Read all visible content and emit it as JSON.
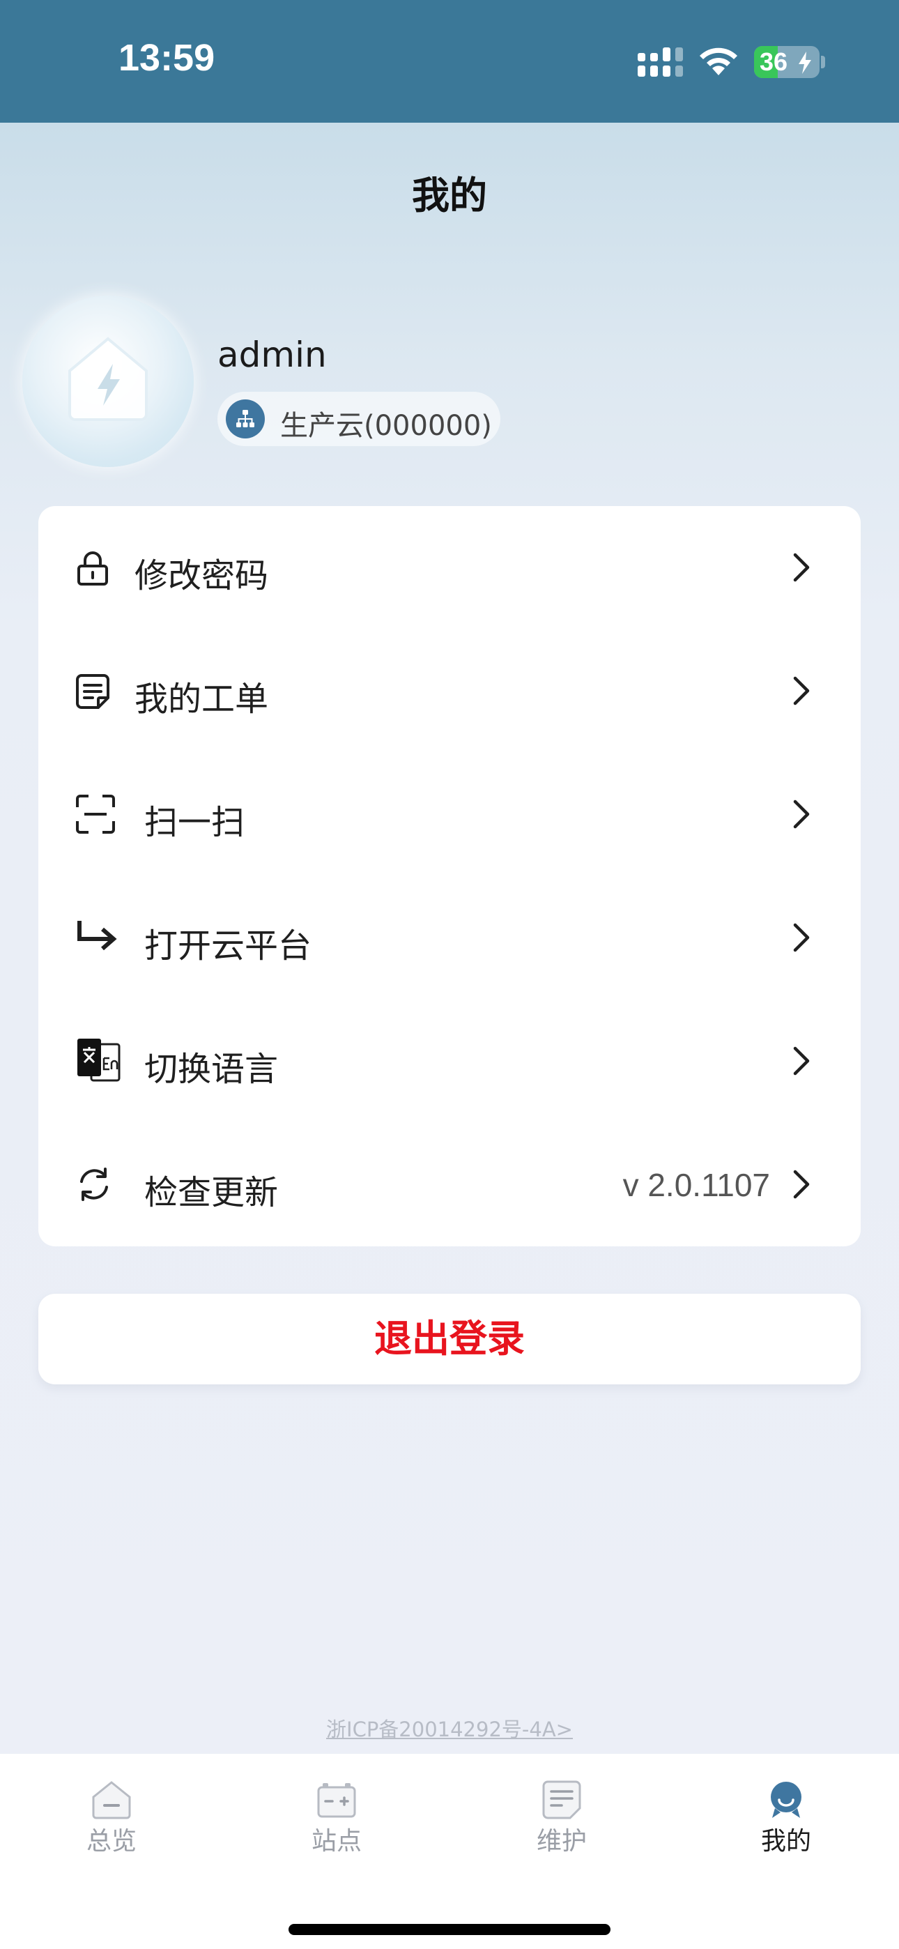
{
  "status_bar": {
    "time": "13:59",
    "battery_percent": "36",
    "battery_level": 0.36,
    "icons": [
      "signal-icon",
      "wifi-icon",
      "battery-charging-icon"
    ]
  },
  "header": {
    "title": "我的"
  },
  "profile": {
    "username": "admin",
    "organization": "生产云(000000)",
    "avatar_icon": "home-lightning-icon",
    "org_icon": "org-tree-icon"
  },
  "menu": {
    "items": [
      {
        "label": "修改密码",
        "icon": "lock-icon"
      },
      {
        "label": "我的工单",
        "icon": "document-icon"
      },
      {
        "label": "扫一扫",
        "icon": "scan-icon"
      },
      {
        "label": "打开云平台",
        "icon": "arrow-turn-right-icon"
      },
      {
        "label": "切换语言",
        "icon": "translate-icon"
      },
      {
        "label": "检查更新",
        "icon": "refresh-icon",
        "value": "v 2.0.1107"
      }
    ]
  },
  "logout_label": "退出登录",
  "footer": {
    "icp": "浙ICP备20014292号-4A>"
  },
  "tab_bar": {
    "tabs": [
      {
        "label": "总览",
        "icon": "home-icon",
        "active": false
      },
      {
        "label": "站点",
        "icon": "battery-station-icon",
        "active": false
      },
      {
        "label": "维护",
        "icon": "document-icon",
        "active": false
      },
      {
        "label": "我的",
        "icon": "user-icon",
        "active": true
      }
    ]
  },
  "colors": {
    "status_bar": "#3b7898",
    "accent": "#3f76a0",
    "logout": "#e8141e",
    "inactive_tab": "#9a9ea6"
  }
}
